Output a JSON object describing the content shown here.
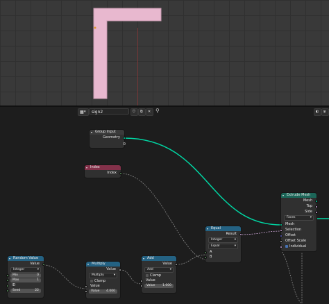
{
  "header": {
    "tree_name": "sign2",
    "icons": [
      "node-tree-icon",
      "chevron-down-icon",
      "fake-user-icon",
      "duplicate-icon",
      "pin-icon",
      "overlay-icon",
      "snap-icon"
    ]
  },
  "colors": {
    "geometry_socket": "#00d6a3",
    "integer_socket": "#598c5c",
    "boolean_socket": "#cca6d6",
    "vector_socket": "#6363c7",
    "input_header": "#3b3b3b",
    "attribute_header": "#83314a",
    "utility_header": "#246283",
    "geometry_header": "#1c6658",
    "mesh_color": "#e8b8cf"
  },
  "nodes": {
    "group_input": {
      "title": "Group Input",
      "geometry": "Geometry"
    },
    "index": {
      "title": "Index",
      "index": "Index"
    },
    "random_value": {
      "title": "Random Value",
      "value_out": "Value",
      "type": "Integer",
      "min_label": "Min",
      "min_value": "0",
      "max_label": "Max",
      "max_value": "1",
      "id_label": "ID",
      "seed_label": "Seed",
      "seed_value": "22"
    },
    "multiply": {
      "title": "Multiply",
      "value_out": "Value",
      "operation": "Multiply",
      "clamp": "Clamp",
      "value_in": "Value",
      "value_field": "Value",
      "value_field_value": "4.000"
    },
    "add": {
      "title": "Add",
      "value_out": "Value",
      "operation": "Add",
      "clamp": "Clamp",
      "value_in": "Value",
      "value_field": "Value",
      "value_field_value": "1.000"
    },
    "equal": {
      "title": "Equal",
      "result": "Result",
      "type": "Integer",
      "mode": "Equal",
      "a": "A",
      "b": "B"
    },
    "extrude_mesh": {
      "title": "Extrude Mesh",
      "mesh_out": "Mesh",
      "top": "Top",
      "side": "Side",
      "mode": "Faces",
      "mesh_in": "Mesh",
      "selection": "Selection",
      "offset": "Offset",
      "offset_scale": "Offset Scale",
      "individual": "Individual"
    }
  }
}
